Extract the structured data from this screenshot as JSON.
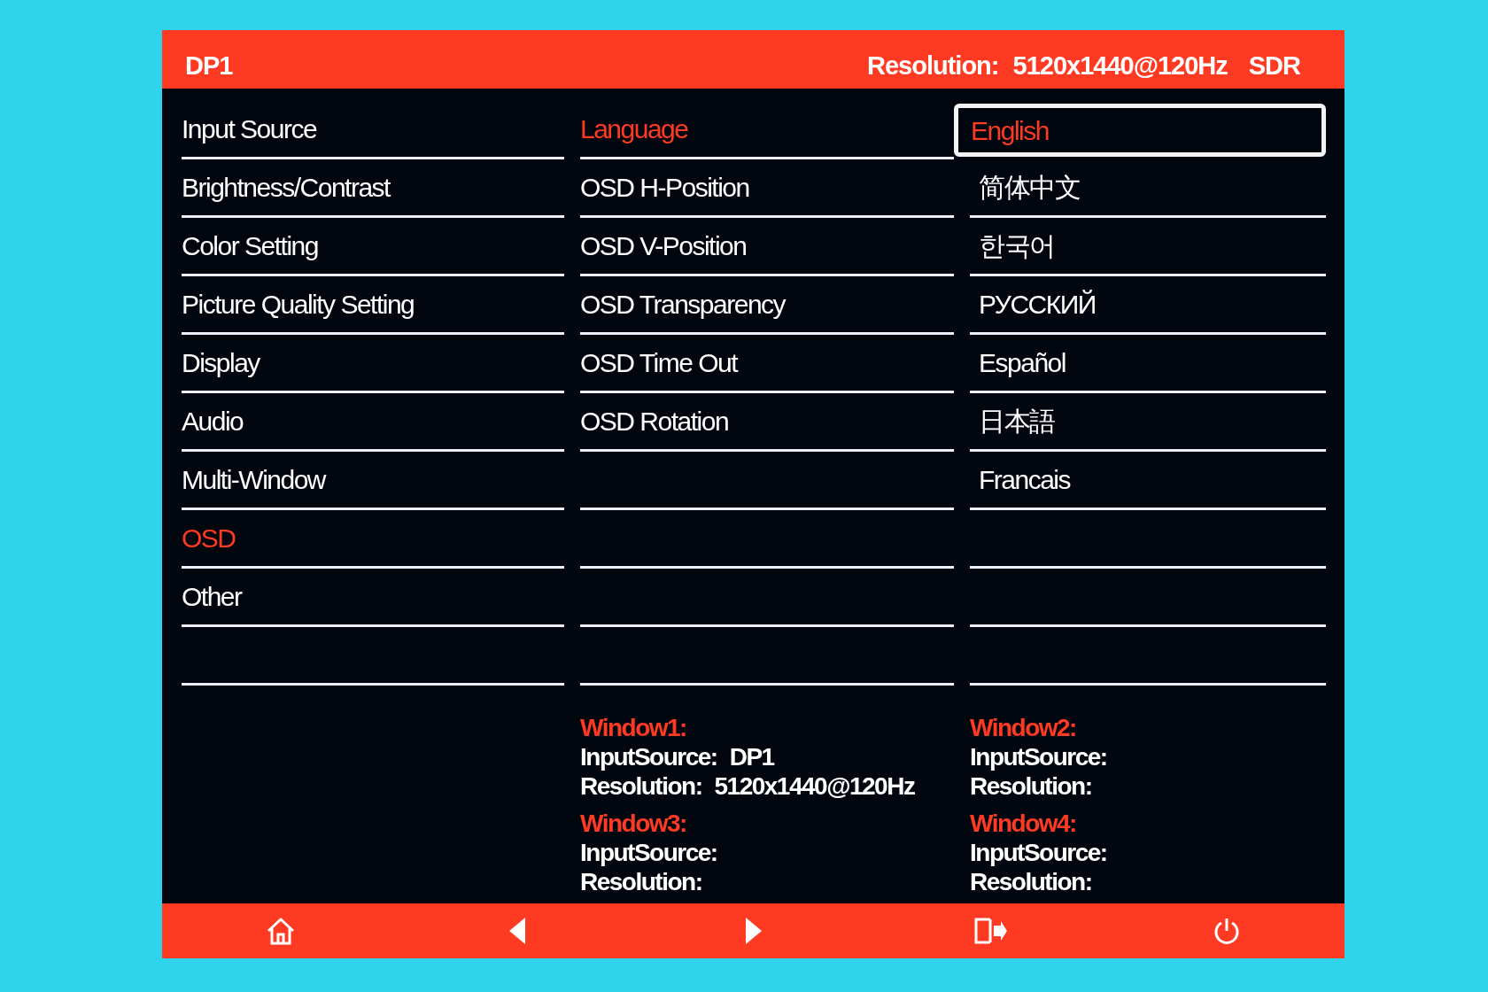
{
  "header": {
    "input": "DP1",
    "resolution_label": "Resolution:",
    "resolution_value": "5120x1440@120Hz",
    "dynamic_range": "SDR"
  },
  "menu": [
    {
      "label": "Input Source",
      "selected": false
    },
    {
      "label": "Brightness/Contrast",
      "selected": false
    },
    {
      "label": "Color Setting",
      "selected": false
    },
    {
      "label": "Picture Quality Setting",
      "selected": false
    },
    {
      "label": "Display",
      "selected": false
    },
    {
      "label": "Audio",
      "selected": false
    },
    {
      "label": "Multi-Window",
      "selected": false
    },
    {
      "label": "OSD",
      "selected": true
    },
    {
      "label": "Other",
      "selected": false
    }
  ],
  "submenu": [
    {
      "label": "Language",
      "selected": true
    },
    {
      "label": "OSD H-Position",
      "selected": false
    },
    {
      "label": "OSD V-Position",
      "selected": false
    },
    {
      "label": "OSD Transparency",
      "selected": false
    },
    {
      "label": "OSD Time Out",
      "selected": false
    },
    {
      "label": "OSD Rotation",
      "selected": false
    }
  ],
  "options": [
    {
      "label": "English",
      "selected": true
    },
    {
      "label": "简体中文",
      "selected": false
    },
    {
      "label": "한국어",
      "selected": false
    },
    {
      "label": "РУССКИЙ",
      "selected": false
    },
    {
      "label": "Español",
      "selected": false
    },
    {
      "label": "日本語",
      "selected": false
    },
    {
      "label": "Francais",
      "selected": false
    }
  ],
  "windows": [
    {
      "title": "Window1:",
      "input_source_label": "InputSource:",
      "input_source_value": "DP1",
      "resolution_label": "Resolution:",
      "resolution_value": "5120x1440@120Hz"
    },
    {
      "title": "Window2:",
      "input_source_label": "InputSource:",
      "resolution_label": "Resolution:"
    },
    {
      "title": "Window3:",
      "input_source_label": "InputSource:",
      "resolution_label": "Resolution:"
    },
    {
      "title": "Window4:",
      "input_source_label": "InputSource:",
      "resolution_label": "Resolution:"
    }
  ],
  "footer_buttons": [
    {
      "kind": "home"
    },
    {
      "kind": "left"
    },
    {
      "kind": "right"
    },
    {
      "kind": "exit"
    },
    {
      "kind": "power"
    }
  ]
}
